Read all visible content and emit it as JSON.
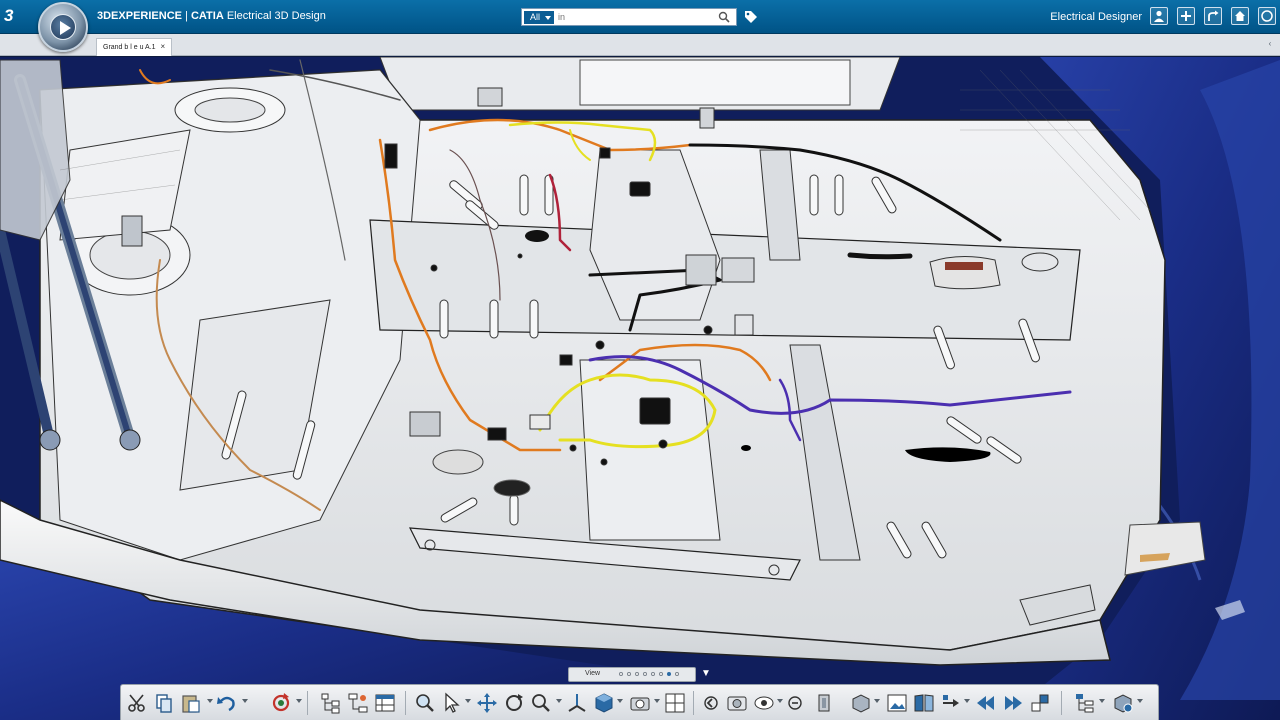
{
  "app": {
    "brand": "3DEXPERIENCE",
    "separator": " | ",
    "product": "CATIA",
    "app_name": "Electrical 3D Design"
  },
  "search": {
    "scope": "All",
    "placeholder": "in"
  },
  "user": {
    "role_label": "Electrical Designer"
  },
  "tab": {
    "label": "Grand b l e u A.1",
    "close": "×"
  },
  "viewbar": {
    "label": "View",
    "dots": 8,
    "active_dot": 7
  },
  "icons": {
    "compass": "compass-icon",
    "search": "search-icon",
    "tag": "tag-icon",
    "user": "user-icon",
    "add": "plus-icon",
    "share": "share-icon",
    "home": "home-icon",
    "help": "help-icon"
  },
  "colors": {
    "topbar": "#005386",
    "car_body": "#1c2f8a",
    "floor": "#f2f2f2",
    "wire_orange": "#e07a1f",
    "wire_yellow": "#e5e021",
    "wire_purple": "#4b2fb0",
    "wire_black": "#111111"
  }
}
